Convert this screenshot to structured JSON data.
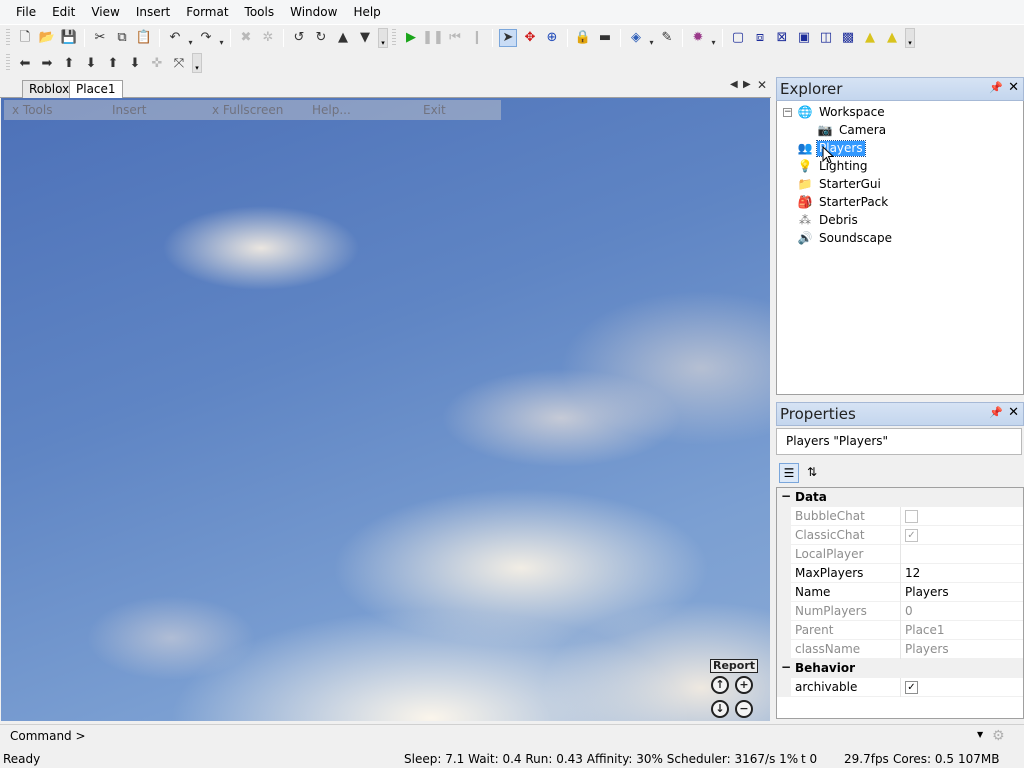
{
  "menu": [
    "File",
    "Edit",
    "View",
    "Insert",
    "Format",
    "Tools",
    "Window",
    "Help"
  ],
  "toolbar_icons": {
    "row1": [
      "new-file-icon",
      "open-folder-icon",
      "save-icon",
      "cut-icon",
      "copy-icon",
      "paste-icon",
      "undo-icon",
      "redo-icon",
      "delete-icon",
      "group-icon",
      "rotate-left-icon",
      "rotate-right-icon",
      "move-up-icon",
      "move-down-icon",
      "play-icon",
      "pause-icon",
      "stop-icon",
      "select-icon",
      "move-icon",
      "resize-icon",
      "lock-icon",
      "anchor-icon",
      "fill-icon",
      "paint-icon",
      "dropper-icon",
      "camera-icon",
      "box-icon",
      "triangle-icon"
    ],
    "row2": [
      "arrow-left-icon",
      "arrow-right-icon",
      "arrow-up-left-icon",
      "arrow-down-left-icon",
      "arrow-up-icon",
      "arrow-down-icon",
      "zoom-in-icon",
      "zoom-extents-icon"
    ]
  },
  "tabs": [
    "Roblox",
    "Place1"
  ],
  "viewport_menu": [
    "x Tools",
    "Insert",
    "x Fullscreen",
    "Help...",
    "Exit"
  ],
  "viewport_report": "Report",
  "explorer": {
    "title": "Explorer",
    "items": [
      {
        "label": "Workspace",
        "icon": "globe-icon"
      },
      {
        "label": "Camera",
        "icon": "camera-icon"
      },
      {
        "label": "Players",
        "icon": "players-icon",
        "selected": true
      },
      {
        "label": "Lighting",
        "icon": "lightbulb-icon"
      },
      {
        "label": "StarterGui",
        "icon": "folder-icon"
      },
      {
        "label": "StarterPack",
        "icon": "backpack-icon"
      },
      {
        "label": "Debris",
        "icon": "debris-icon"
      },
      {
        "label": "Soundscape",
        "icon": "sound-icon"
      }
    ]
  },
  "properties": {
    "title": "Properties",
    "selected_object": "Players \"Players\"",
    "categories": [
      {
        "name": "Data",
        "rows": [
          {
            "name": "BubbleChat",
            "type": "checkbox",
            "checked": false,
            "readonly": true
          },
          {
            "name": "ClassicChat",
            "type": "checkbox",
            "checked": true,
            "readonly": true
          },
          {
            "name": "LocalPlayer",
            "value": "",
            "readonly": true
          },
          {
            "name": "MaxPlayers",
            "value": "12",
            "readonly": false
          },
          {
            "name": "Name",
            "value": "Players",
            "readonly": false
          },
          {
            "name": "NumPlayers",
            "value": "0",
            "readonly": true
          },
          {
            "name": "Parent",
            "value": "Place1",
            "readonly": true
          },
          {
            "name": "className",
            "value": "Players",
            "readonly": true
          }
        ]
      },
      {
        "name": "Behavior",
        "rows": [
          {
            "name": "archivable",
            "type": "checkbox",
            "checked": true,
            "readonly": false
          }
        ]
      }
    ]
  },
  "command": {
    "label": "Command >",
    "value": ""
  },
  "status": {
    "ready": "Ready",
    "stats": "Sleep: 7.1 Wait: 0.4 Run: 0.43 Affinity: 30% Scheduler: 3167/s 1%",
    "t": "t 0",
    "fps": "29.7fps",
    "cores": "Cores: 0.5",
    "mem": "107MB"
  }
}
